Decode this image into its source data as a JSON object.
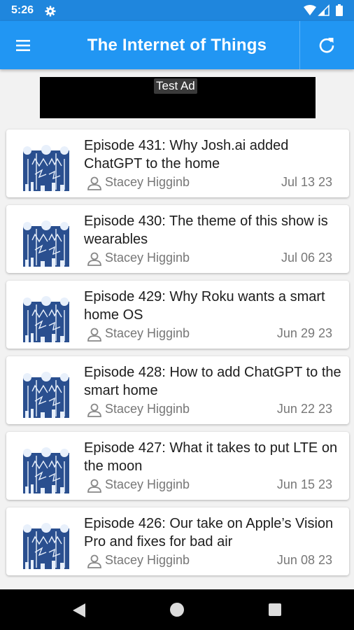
{
  "status_bar": {
    "time": "5:26"
  },
  "app_bar": {
    "title": "The Internet of Things"
  },
  "ad": {
    "label": "Test Ad"
  },
  "episodes": [
    {
      "title": "Episode 431: Why Josh.ai added ChatGPT to the home",
      "author": "Stacey Higginb",
      "date": "Jul 13 23"
    },
    {
      "title": "Episode 430: The theme of this show is wearables",
      "author": "Stacey Higginb",
      "date": "Jul 06 23"
    },
    {
      "title": "Episode 429: Why Roku wants a smart home OS",
      "author": "Stacey Higginb",
      "date": "Jun 29 23"
    },
    {
      "title": "Episode 428: How to add ChatGPT to the smart home",
      "author": "Stacey Higginb",
      "date": "Jun 22 23"
    },
    {
      "title": "Episode 427: What it takes to put LTE on the moon",
      "author": "Stacey Higginb",
      "date": "Jun 15 23"
    },
    {
      "title": "Episode 426: Our take on Apple’s Vision Pro and fixes for bad air",
      "author": "Stacey Higginb",
      "date": "Jun 08 23"
    }
  ],
  "colors": {
    "app_bar": "#2196f3",
    "status_bar": "#1f86dd",
    "thumb_blue": "#2a4f8f"
  },
  "icons": {
    "menu": "hamburger-icon",
    "refresh": "refresh-icon",
    "author": "person-icon"
  }
}
